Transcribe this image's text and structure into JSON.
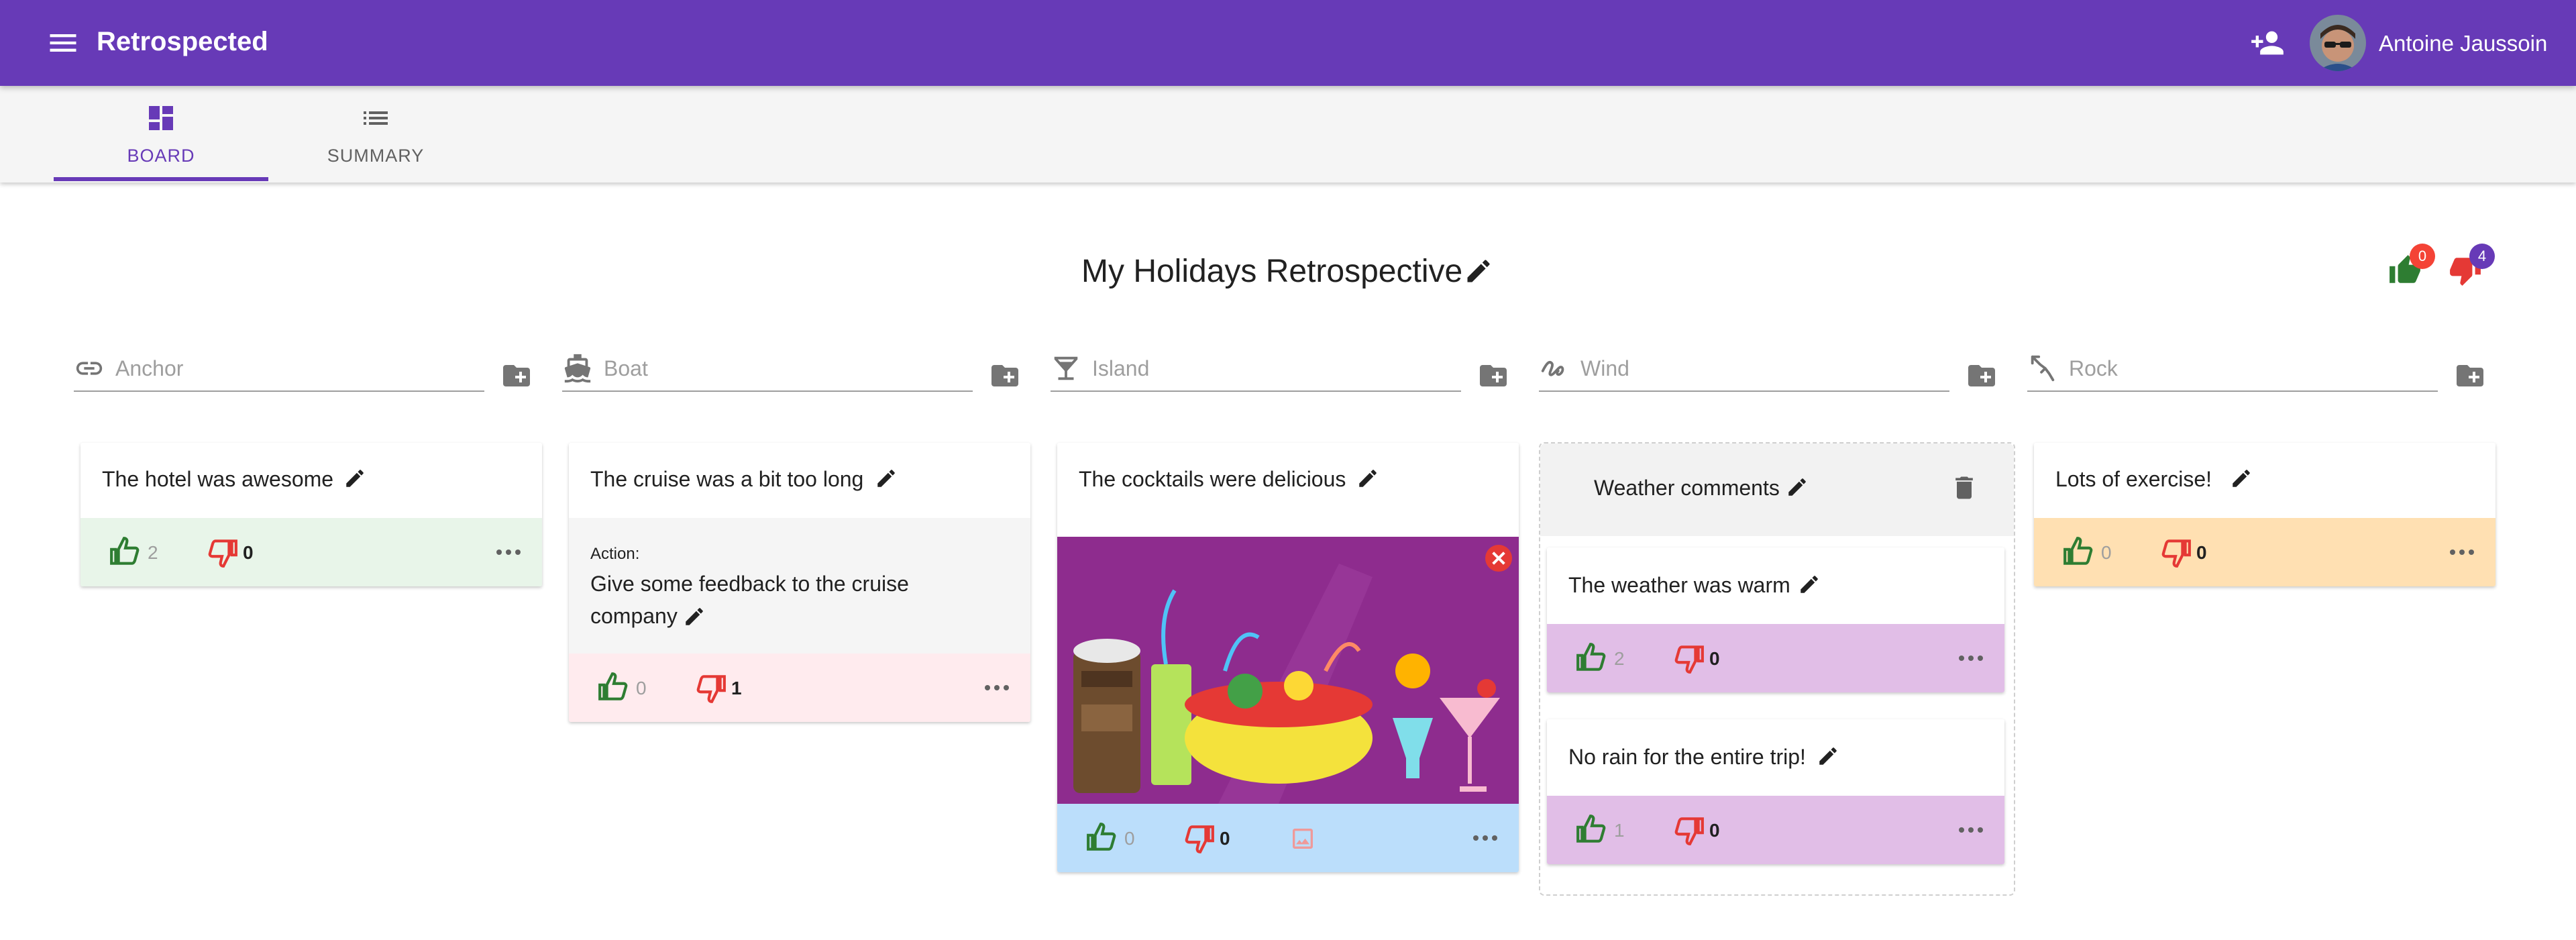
{
  "app": {
    "title": "Retrospected",
    "user_name": "Antoine Jaussoin"
  },
  "tabs": [
    {
      "label": "BOARD",
      "active": true
    },
    {
      "label": "SUMMARY",
      "active": false
    }
  ],
  "board": {
    "title": "My Holidays Retrospective",
    "likes_left": "0",
    "dislikes_left": "4"
  },
  "columns": [
    {
      "icon": "link-icon",
      "placeholder": "Anchor"
    },
    {
      "icon": "boat-icon",
      "placeholder": "Boat"
    },
    {
      "icon": "cocktail-icon",
      "placeholder": "Island"
    },
    {
      "icon": "wind-icon",
      "placeholder": "Wind"
    },
    {
      "icon": "rock-climbing-icon",
      "placeholder": "Rock"
    }
  ],
  "cards": {
    "anchor": {
      "text": "The hotel was awesome",
      "up": "2",
      "down": "0"
    },
    "boat": {
      "text": "The cruise was a bit too long",
      "action_label": "Action:",
      "action_line1": "Give some feedback to the cruise",
      "action_line2": "company",
      "up": "0",
      "down": "1"
    },
    "island": {
      "text": "The cocktails were delicious",
      "up": "0",
      "down": "0"
    },
    "wind_group": {
      "title": "Weather comments"
    },
    "wind1": {
      "text": "The weather was warm",
      "up": "2",
      "down": "0"
    },
    "wind2": {
      "text": "No rain for the entire trip!",
      "up": "1",
      "down": "0"
    },
    "rock": {
      "text": "Lots of exercise!",
      "up": "0",
      "down": "0"
    }
  },
  "colors": {
    "primary": "#673ab7",
    "anchor_footer": "#e8f5e9",
    "boat_footer": "#ffebee",
    "island_footer": "#bbdefb",
    "wind_footer": "#e1bee7",
    "rock_footer": "#ffe0b2",
    "like": "#2e7d32",
    "dislike": "#e53935"
  }
}
